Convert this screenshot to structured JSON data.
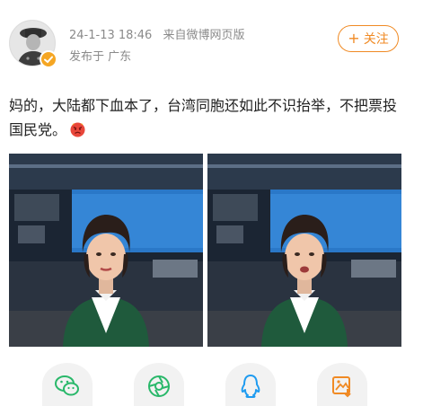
{
  "post": {
    "timestamp": "24-1-13 18:46",
    "source": "来自微博网页版",
    "location": "发布于 广东",
    "text": "妈的，大陆都下血本了，台湾同胞还如此不识抬举，不把票投国民党。",
    "emoji": "angry-emoji"
  },
  "follow_button": {
    "plus": "+",
    "label": "关注"
  },
  "colors": {
    "accent": "#f08a24",
    "meta_text": "#8a8a8a",
    "studio_screen": "#2a78c8",
    "jacket": "#1f5a3c"
  },
  "images": [
    {
      "name": "news-anchor-photo-1"
    },
    {
      "name": "news-anchor-photo-2"
    }
  ],
  "share": [
    {
      "name": "wechat-share-button",
      "icon": "wechat-icon"
    },
    {
      "name": "moments-share-button",
      "icon": "moments-icon"
    },
    {
      "name": "qq-share-button",
      "icon": "qq-icon"
    },
    {
      "name": "save-image-button",
      "icon": "save-image-icon"
    }
  ]
}
